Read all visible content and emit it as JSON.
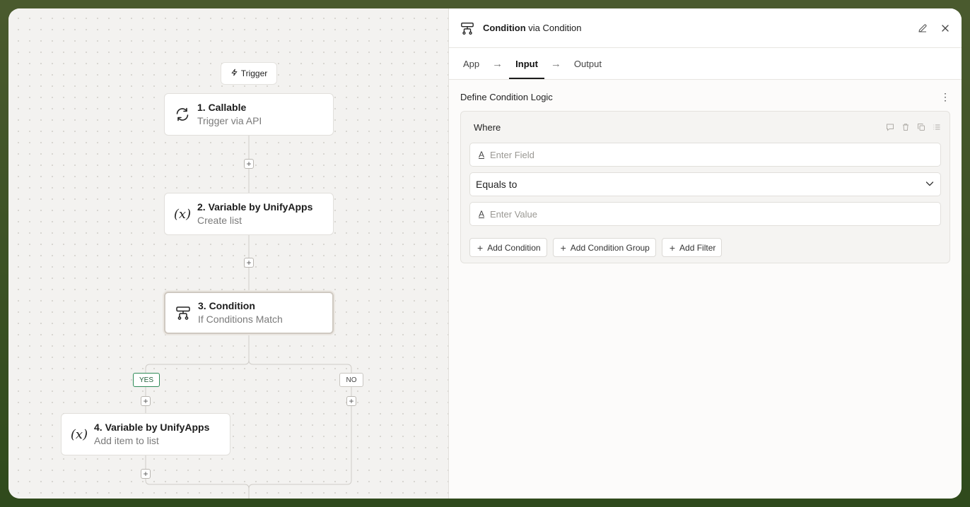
{
  "canvas": {
    "trigger_label": "Trigger",
    "nodes": [
      {
        "title": "1. Callable",
        "subtitle": "Trigger via API",
        "icon": "refresh-icon"
      },
      {
        "title": "2. Variable by UnifyApps",
        "subtitle": "Create list",
        "icon": "variable-icon",
        "icon_text": "(x)"
      },
      {
        "title": "3. Condition",
        "subtitle": "If Conditions Match",
        "icon": "condition-icon"
      },
      {
        "title": "4. Variable by UnifyApps",
        "subtitle": "Add item to list",
        "icon": "variable-icon",
        "icon_text": "(x)"
      }
    ],
    "add_symbol": "+",
    "yes_label": "YES",
    "no_label": "NO"
  },
  "panel": {
    "title_bold": "Condition",
    "title_rest": " via Condition",
    "tabs": [
      "App",
      "Input",
      "Output"
    ],
    "active_tab": "Input",
    "arrow": "→",
    "section_title": "Define Condition Logic",
    "kebab": "⋮",
    "where_label": "Where",
    "field_placeholder": "Enter Field",
    "field_icon_text": "A",
    "operator_value": "Equals to",
    "value_placeholder": "Enter Value",
    "buttons": {
      "add_condition": "Add Condition",
      "add_condition_group": "Add Condition Group",
      "add_filter": "Add Filter"
    },
    "plus": "+"
  }
}
